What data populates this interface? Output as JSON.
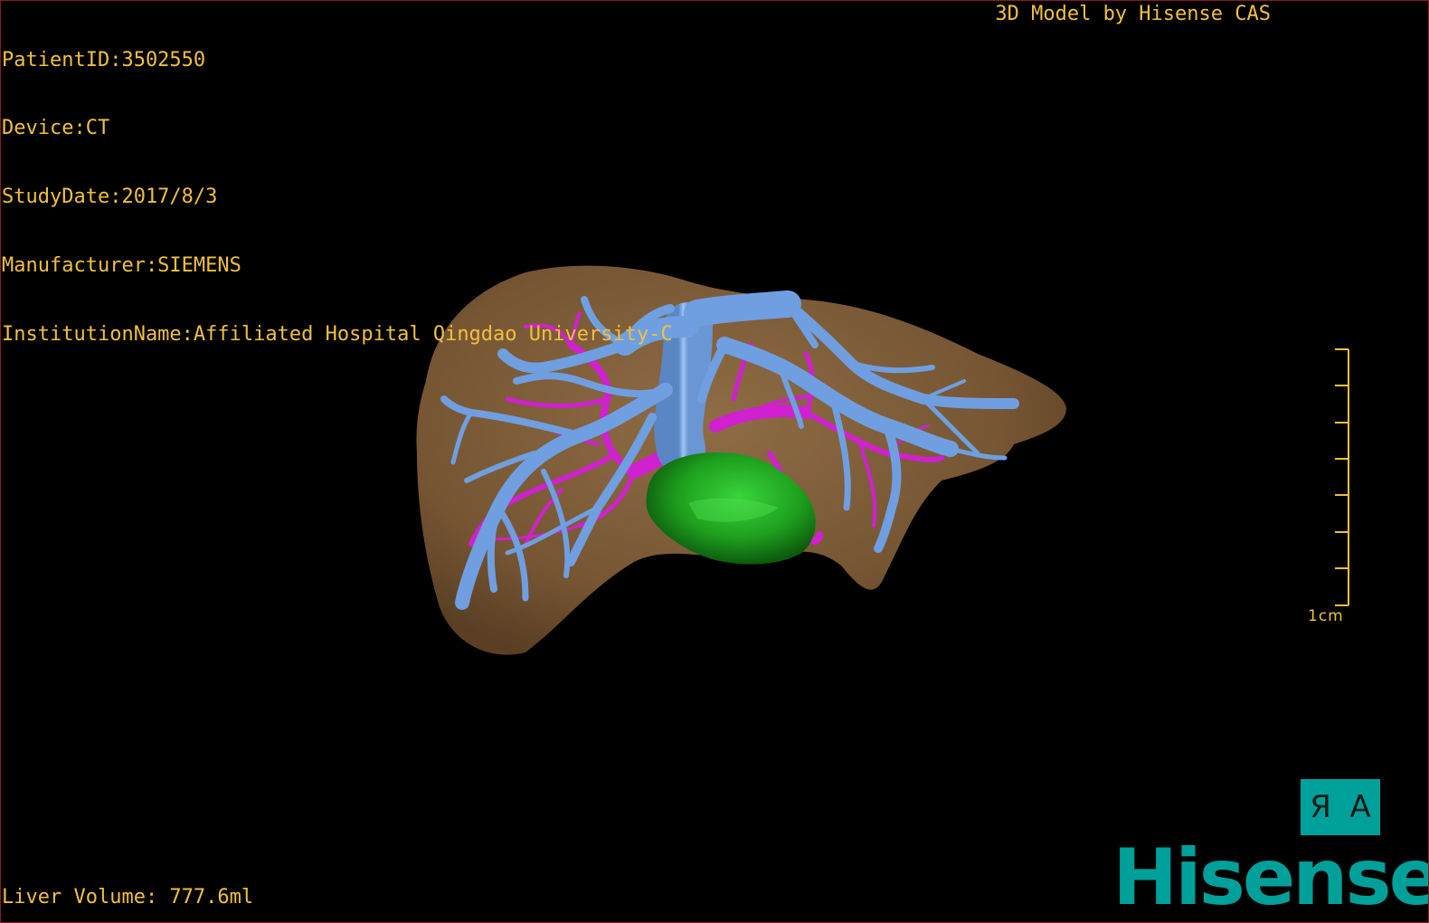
{
  "patient_info": {
    "patient_id": "PatientID:3502550",
    "device": "Device:CT",
    "study_date": "StudyDate:2017/8/3",
    "manufacturer": "Manufacturer:SIEMENS",
    "institution": "InstitutionName:Affiliated Hospital Qingdao University-C"
  },
  "model_credit": "3D Model by Hisense CAS",
  "liver_volume": "Liver Volume: 777.6ml",
  "scale_bar": {
    "label": "1cm"
  },
  "orientation_button": {
    "left_glyph": "Я",
    "right_glyph": "A"
  },
  "brand": "Hisense",
  "colors": {
    "overlay_text": "#f0c040",
    "liver": "#7a5a36",
    "portal_vein": "#6f9fe0",
    "hepatic_artery": "#d020d0",
    "gallbladder": "#22b020",
    "brand": "#00a09a"
  },
  "scene_labels": {
    "liver": "liver-surface",
    "veins": "portal-vein-tree",
    "arteries": "hepatic-artery-tree",
    "gallbladder": "gallbladder"
  }
}
